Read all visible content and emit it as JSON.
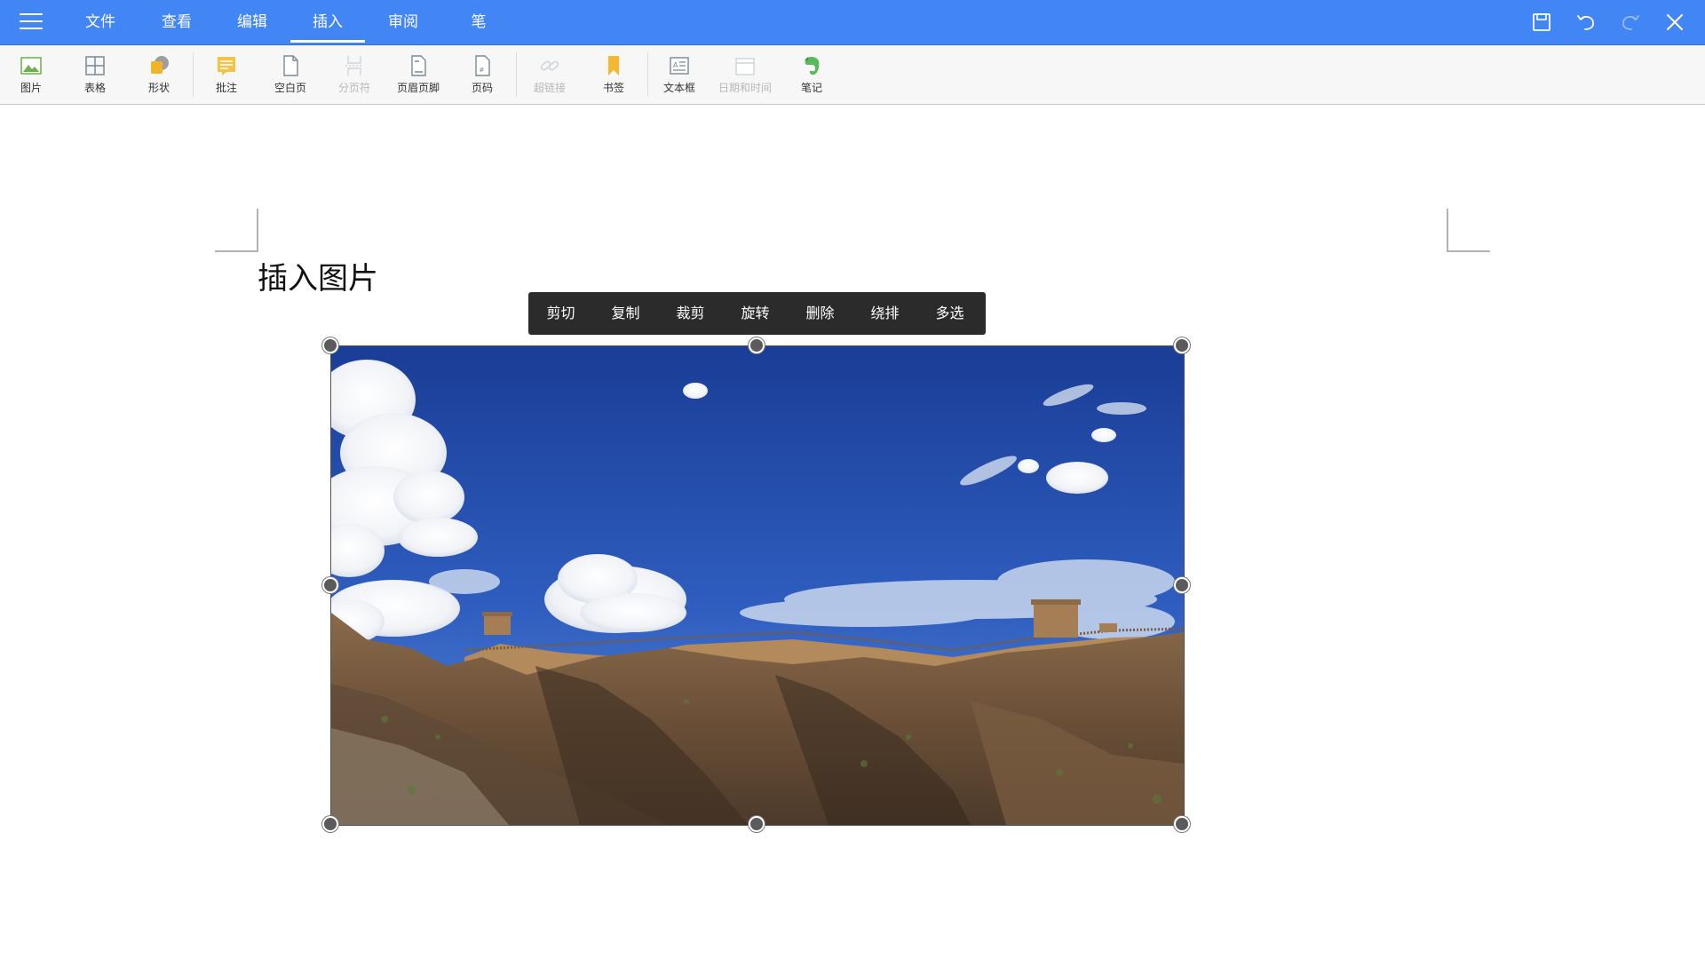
{
  "colors": {
    "accent": "#4285f4",
    "ribbon_bg": "#f7f7f7",
    "context_menu_bg": "#2b2b2b"
  },
  "topbar": {
    "menu_icon": "hamburger-icon",
    "tabs": [
      {
        "label": "文件"
      },
      {
        "label": "查看"
      },
      {
        "label": "编辑"
      },
      {
        "label": "插入",
        "active": true
      },
      {
        "label": "审阅"
      },
      {
        "label": "笔"
      }
    ],
    "window_icons": [
      "save-icon",
      "undo-icon",
      "redo-icon",
      "close-icon"
    ]
  },
  "ribbon": {
    "items": [
      {
        "label": "图片",
        "icon": "picture-icon",
        "enabled": true
      },
      {
        "label": "表格",
        "icon": "table-icon",
        "enabled": true
      },
      {
        "label": "形状",
        "icon": "shape-icon",
        "enabled": true
      },
      {
        "label": "批注",
        "icon": "comment-icon",
        "enabled": true
      },
      {
        "label": "空白页",
        "icon": "blank-page-icon",
        "enabled": true
      },
      {
        "label": "分页符",
        "icon": "page-break-icon",
        "enabled": false
      },
      {
        "label": "页眉页脚",
        "icon": "header-footer-icon",
        "enabled": true
      },
      {
        "label": "页码",
        "icon": "page-number-icon",
        "enabled": true
      },
      {
        "label": "超链接",
        "icon": "hyperlink-icon",
        "enabled": false
      },
      {
        "label": "书签",
        "icon": "bookmark-icon",
        "enabled": true
      },
      {
        "label": "文本框",
        "icon": "textbox-icon",
        "enabled": true
      },
      {
        "label": "日期和时间",
        "icon": "datetime-icon",
        "enabled": false
      },
      {
        "label": "笔记",
        "icon": "evernote-icon",
        "enabled": true
      }
    ]
  },
  "document": {
    "heading": "插入图片",
    "image": {
      "subject": "great-wall-landscape-photo",
      "selected": true
    }
  },
  "context_menu": {
    "items": [
      "剪切",
      "复制",
      "裁剪",
      "旋转",
      "删除",
      "绕排",
      "多选"
    ]
  }
}
